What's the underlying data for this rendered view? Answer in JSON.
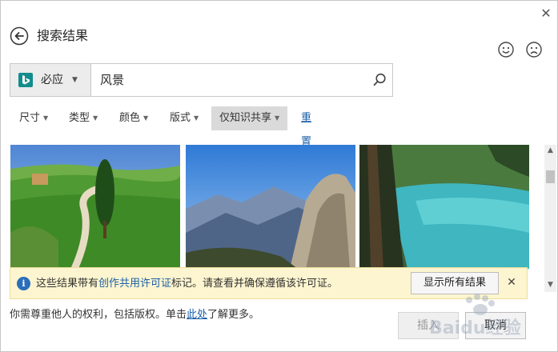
{
  "dialog": {
    "title": "搜索结果",
    "close_symbol": "✕"
  },
  "feedback": {
    "happy_icon": "smiley-face-icon",
    "sad_icon": "frown-face-icon"
  },
  "search": {
    "engine_label": "必应",
    "engine_caret": "▼",
    "query": "风景",
    "engine_color": "#128d8d"
  },
  "filters": {
    "items": [
      {
        "label": "尺寸",
        "caret": "▼"
      },
      {
        "label": "类型",
        "caret": "▼"
      },
      {
        "label": "颜色",
        "caret": "▼"
      },
      {
        "label": "版式",
        "caret": "▼"
      },
      {
        "label": "仅知识共享",
        "caret": "▼"
      }
    ],
    "reset_label": "重置"
  },
  "results": {
    "items": [
      {
        "name": "green-hills-cypress-road"
      },
      {
        "name": "granite-peaks-mountains"
      },
      {
        "name": "turquoise-lake-forest"
      }
    ]
  },
  "scrollbar": {
    "up_symbol": "▲",
    "down_symbol": "▼"
  },
  "info_bar": {
    "icon_glyph": "i",
    "text_before": "这些结果带有",
    "link_text": "创作共用许可证",
    "text_after": "标记。请查看并确保遵循该许可证。",
    "show_all_label": "显示所有结果",
    "close_symbol": "✕",
    "background_color": "#fcf5cf"
  },
  "footer": {
    "text_before": "你需尊重他人的权利，包括版权。单击",
    "link_text": "此处",
    "text_after": "了解更多。"
  },
  "buttons": {
    "insert_label": "插入",
    "cancel_label": "取消"
  },
  "watermark": {
    "text": "Baidu经验"
  },
  "colors": {
    "link": "#1a5fa8",
    "active_filter_bg": "#dadada"
  }
}
